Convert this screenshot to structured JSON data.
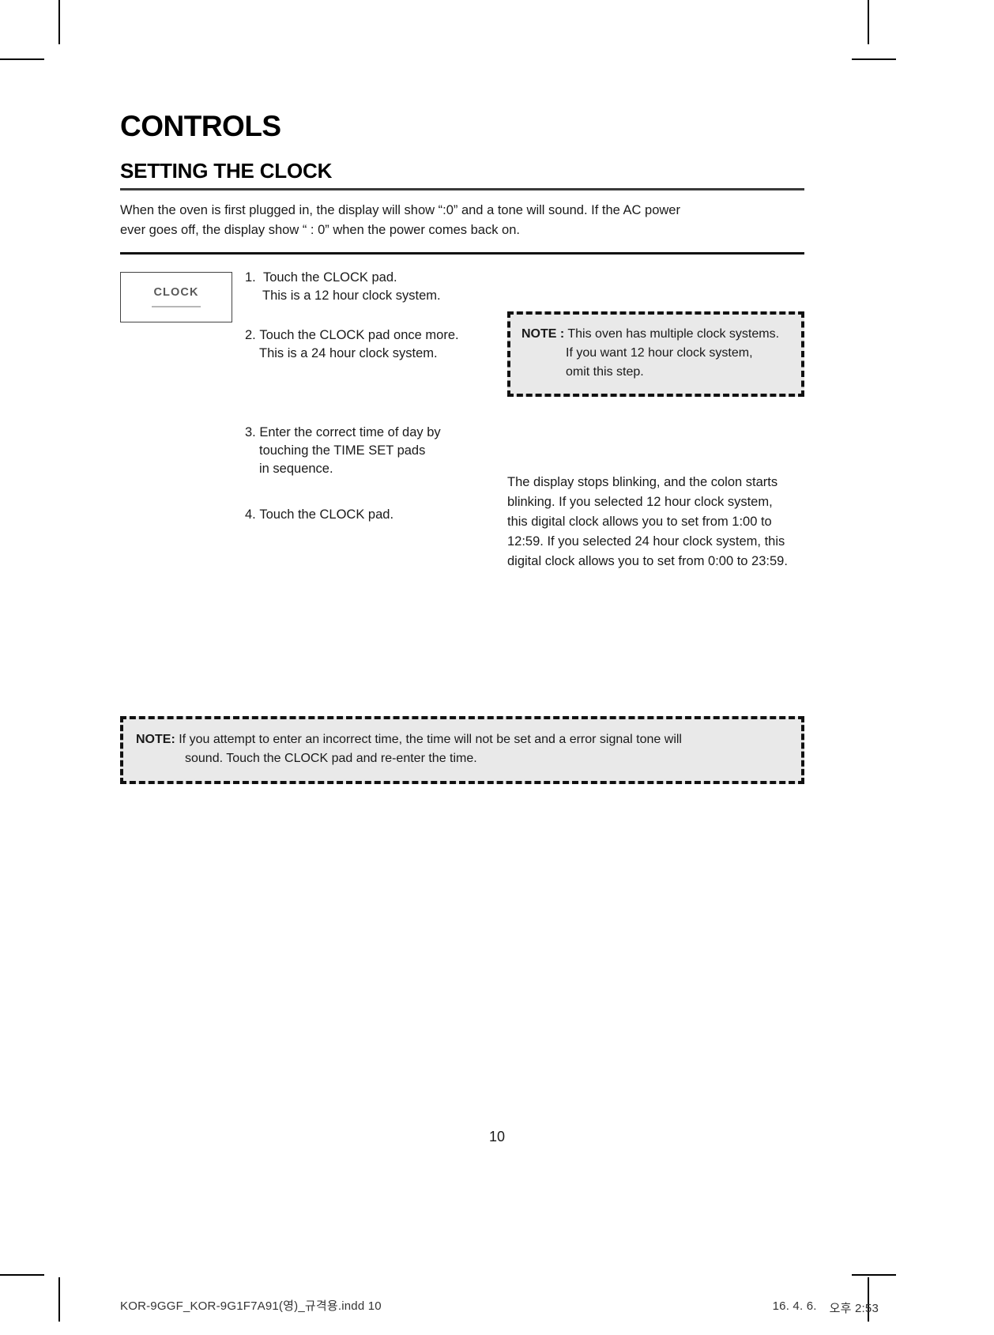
{
  "document": {
    "chapter_title": "CONTROLS",
    "section_title": "SETTING THE CLOCK",
    "intro_line_1": "When the oven is first plugged in, the display will show “:0” and a tone will sound. If the AC power",
    "intro_line_2": "ever goes off, the display show “ : 0” when the power comes back on.",
    "page_number": "10"
  },
  "clock_pad": {
    "label": "CLOCK"
  },
  "steps": [
    {
      "number": "1.",
      "line_1": "Touch the CLOCK pad.",
      "line_2": "This is a 12 hour clock system."
    },
    {
      "number": "2.",
      "line_1": "Touch the CLOCK pad once more.",
      "line_2": "This is a 24 hour clock system."
    },
    {
      "number": "3.",
      "line_1": "Enter the correct time of day by",
      "line_2": "touching the TIME SET pads",
      "line_3": "in sequence."
    },
    {
      "number": "4.",
      "line_1": "Touch the CLOCK pad."
    }
  ],
  "note_top": {
    "label": "NOTE :",
    "line_1": "This oven has multiple clock systems.",
    "line_2": "If  you want 12 hour clock system,",
    "line_3": "omit this step."
  },
  "display_paragraph": {
    "line_1": "The display stops blinking, and the colon starts",
    "line_2": "blinking.  If you selected 12 hour clock system,",
    "line_3": "this digital clock allows you to set from 1:00 to",
    "line_4": "12:59.  If you selected 24 hour clock system, this",
    "line_5": "digital clock allows you to set from 0:00 to 23:59."
  },
  "note_bottom": {
    "label": "NOTE:",
    "line_1": "If you attempt to enter an incorrect time, the time will not be set and a error signal tone will",
    "line_2": "sound. Touch the CLOCK pad and re-enter the time."
  },
  "footer": {
    "file_name": "KOR-9GGF_KOR-9G1F7A91(영)_규격용.indd   10",
    "date": "16. 4. 6.",
    "time": "오후 2:53"
  }
}
